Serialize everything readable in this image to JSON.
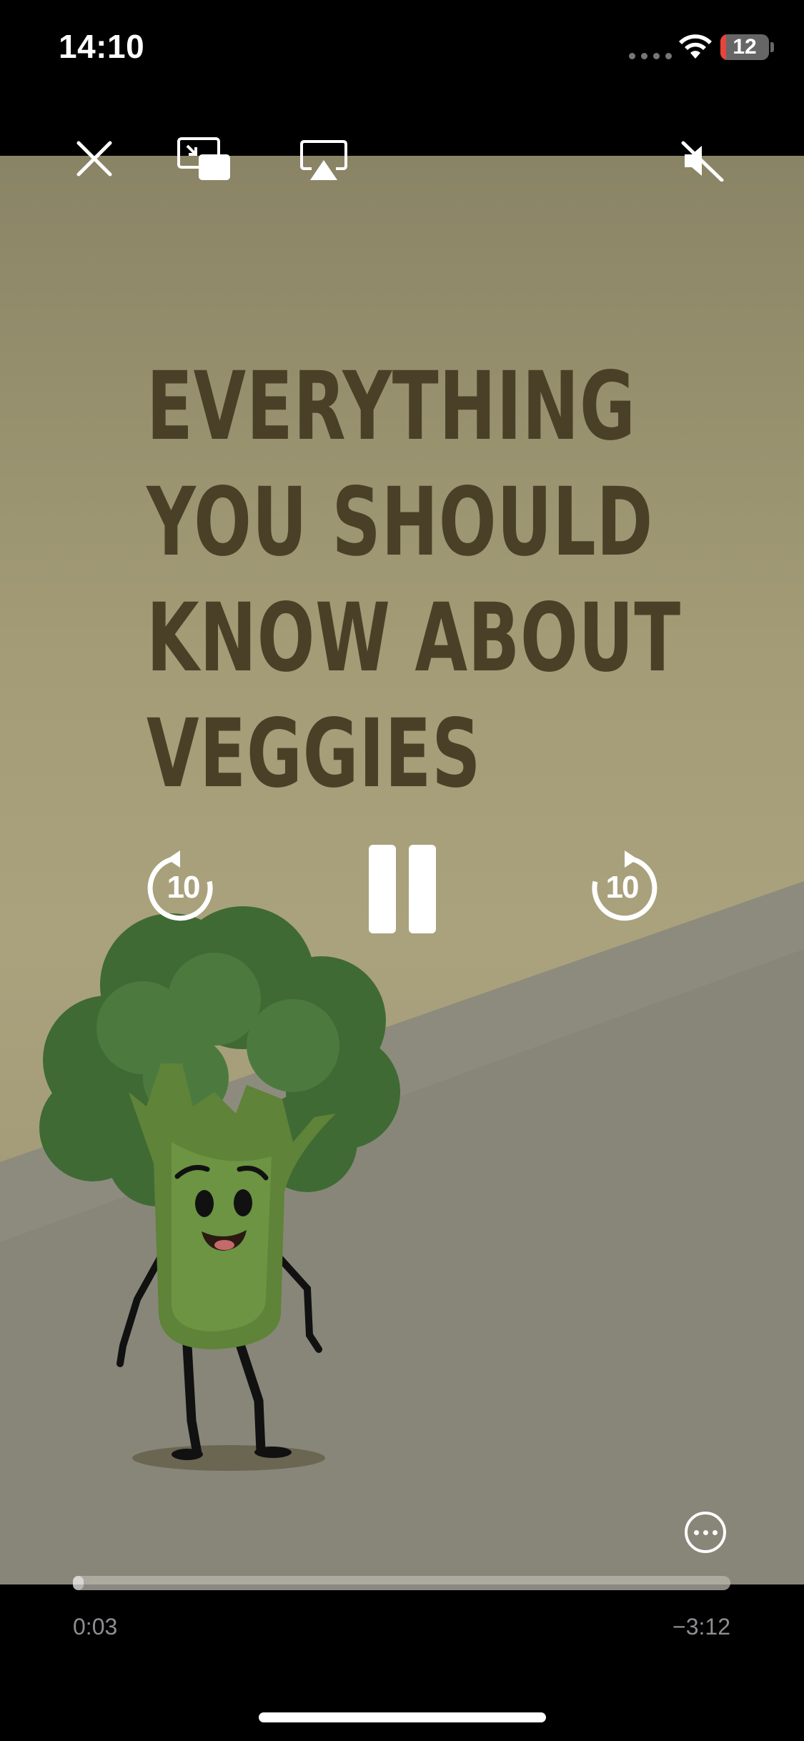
{
  "status_bar": {
    "time": "14:10",
    "battery": "12",
    "battery_level": 0.12,
    "battery_color": "#e5453c"
  },
  "video": {
    "title_lines": [
      "EVERYTHING",
      "YOU SHOULD",
      "KNOW ABOUT",
      "VEGGIES"
    ]
  },
  "controls": {
    "close_icon": "close-icon",
    "pip_icon": "picture-in-picture-icon",
    "airplay_icon": "airplay-icon",
    "mute_icon": "speaker-muted-icon",
    "skip_back_label": "10",
    "skip_forward_label": "10",
    "play_state_icon": "pause-icon",
    "more_icon": "more-options-icon"
  },
  "scrubber": {
    "elapsed": "0:03",
    "remaining": "−3:12",
    "progress": 0.016
  }
}
